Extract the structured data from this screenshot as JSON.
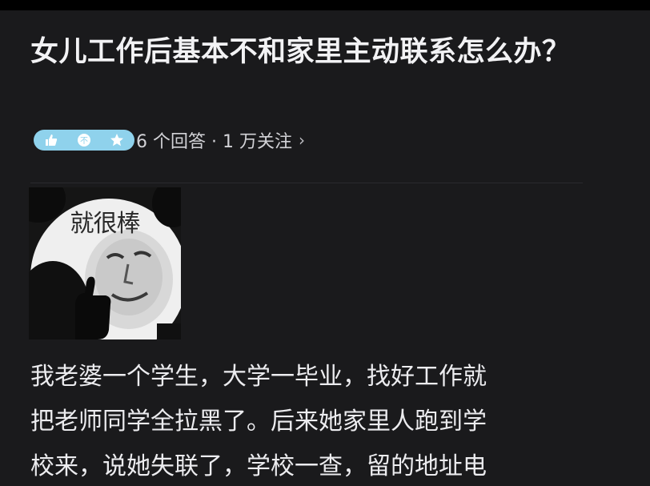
{
  "question": {
    "title": "女儿工作后基本不和家里主动联系怎么办？"
  },
  "meta": {
    "answers_text": "6 个回答 · 1 万关注",
    "chevron": "›",
    "badge_icons": [
      "thumbs-up-icon",
      "not-icon",
      "star-icon"
    ],
    "badge_not_glyph": "不"
  },
  "meme": {
    "caption": "就很棒"
  },
  "answer": {
    "lines": [
      "我老婆一个学生，大学一毕业，找好工作就",
      "把老师同学全拉黑了。后来她家里人跑到学",
      "校来，说她失联了，学校一查，留的地址电"
    ]
  },
  "colors": {
    "background": "#1a1a1c",
    "badge": "#8fd2ec",
    "text": "#e9e9ec"
  }
}
